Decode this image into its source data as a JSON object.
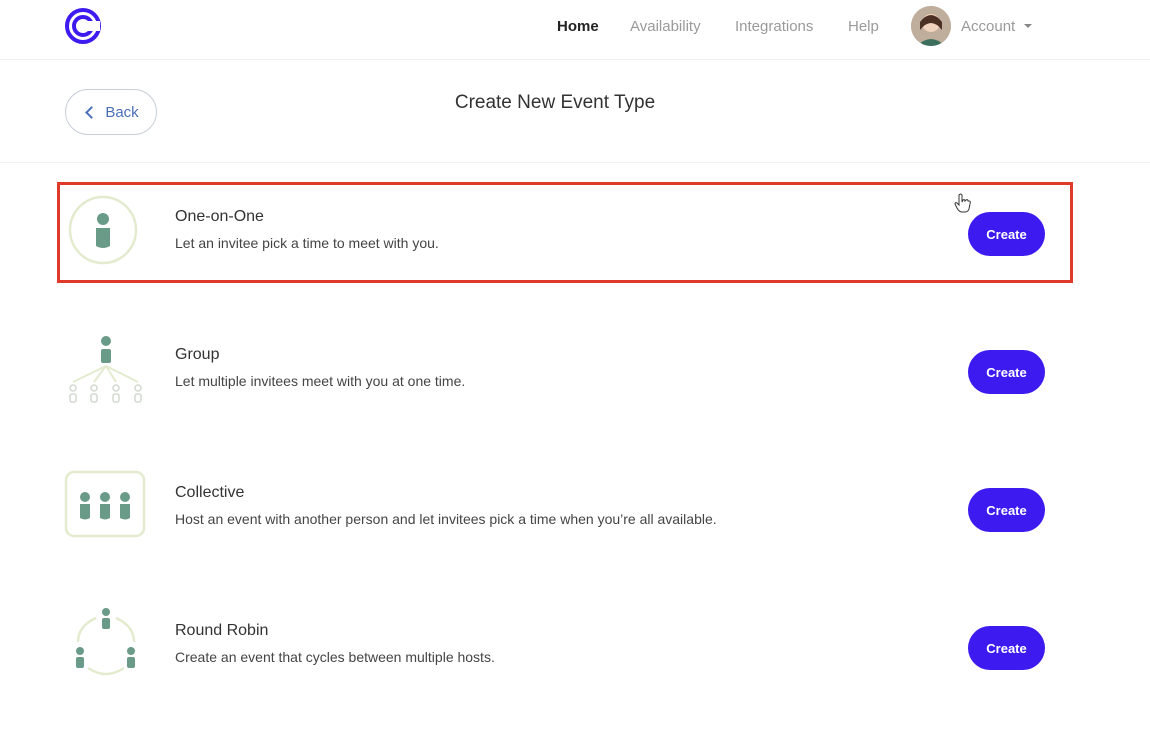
{
  "header": {
    "logo_icon": "calendly-logo-icon",
    "nav": [
      "Home",
      "Availability",
      "Integrations",
      "Help"
    ],
    "account_label": "Account"
  },
  "page": {
    "back_label": "Back",
    "title": "Create New Event Type"
  },
  "event_types": [
    {
      "name": "One-on-One",
      "description": "Let an invitee pick a time to meet with you.",
      "button": "Create",
      "icon": "one-on-one-icon"
    },
    {
      "name": "Group",
      "description": "Let multiple invitees meet with you at one time.",
      "button": "Create",
      "icon": "group-icon"
    },
    {
      "name": "Collective",
      "description": "Host an event with another person and let invitees pick a time when you’re all available.",
      "button": "Create",
      "icon": "collective-icon"
    },
    {
      "name": "Round Robin",
      "description": "Create an event that cycles between multiple hosts.",
      "button": "Create",
      "icon": "round-robin-icon"
    }
  ],
  "colors": {
    "primary_button": "#3d1af0",
    "highlight_border": "#e03a2a",
    "icon_person": "#6a9a88",
    "icon_ring": "#e3ebcf"
  }
}
